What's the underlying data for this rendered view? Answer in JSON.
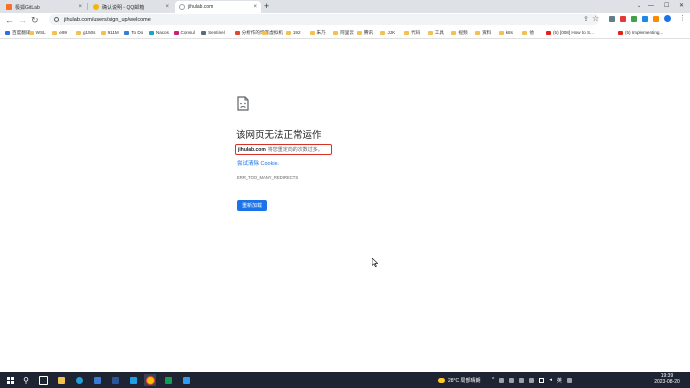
{
  "tabs": [
    {
      "title": "极狐GitLab",
      "favicon_color": "#fc6d26",
      "active": false
    },
    {
      "title": "确认说明 - QQ邮箱",
      "favicon_color": "#f5b50a",
      "active": false
    },
    {
      "title": "jihulab.com",
      "favicon_color": "#9aa0a6",
      "active": true
    }
  ],
  "address": {
    "url": "jihulab.com/users/sign_up/welcome"
  },
  "bookmarks": [
    {
      "label": "百度翻译",
      "color": "#2f6fe4"
    },
    {
      "label": "WSL",
      "color": "#f2c14e"
    },
    {
      "label": "e99",
      "color": "#f2c14e"
    },
    {
      "label": "g150s",
      "color": "#f2c14e"
    },
    {
      "label": "911M",
      "color": "#f2c14e"
    },
    {
      "label": "To Do",
      "color": "#3a7bd5"
    },
    {
      "label": "Nacos",
      "color": "#1aa3c9"
    },
    {
      "label": "Consul",
      "color": "#ca2171"
    },
    {
      "label": "Sentinel",
      "color": "#5a6b7b"
    },
    {
      "label": "分析作的博客",
      "color": "#e5452b"
    },
    {
      "label": "虚拟机",
      "color": "#f2c14e"
    },
    {
      "label": "192",
      "color": "#f2c14e"
    },
    {
      "label": "朱乃",
      "color": "#f2c14e"
    },
    {
      "label": "阿里云",
      "color": "#f2c14e"
    },
    {
      "label": "腾讯",
      "color": "#f2c14e"
    },
    {
      "label": "JJK",
      "color": "#f2c14e"
    },
    {
      "label": "代码",
      "color": "#f2c14e"
    },
    {
      "label": "工具",
      "color": "#f2c14e"
    },
    {
      "label": "视频",
      "color": "#f2c14e"
    },
    {
      "label": "资料",
      "color": "#f2c14e"
    },
    {
      "label": "k8s",
      "color": "#f2c14e"
    },
    {
      "label": "他",
      "color": "#f2c14e"
    },
    {
      "label": "(5) [008] How to S...",
      "color": "#e62117"
    },
    {
      "label": "(5) Implementing...",
      "color": "#e62117"
    }
  ],
  "error": {
    "title": "该网页无法正常运作",
    "domain": "jihulab.com",
    "message": "将您重定向的次数过多。",
    "clear_cookies_link": "尝试清除 Cookie.",
    "code": "ERR_TOO_MANY_REDIRECTS",
    "reload_button": "重新加载"
  },
  "toolbar": {
    "back": "←",
    "forward": "→",
    "reload": "↻"
  },
  "taskbar": {
    "weather": "28°C 局部晴朗",
    "language": "英",
    "time": "19:39",
    "date": "2023-08-20"
  },
  "icons": {
    "window_min": "—",
    "window_max": "☐",
    "window_close": "✕",
    "new_tab": "+",
    "tab_close": "×"
  }
}
